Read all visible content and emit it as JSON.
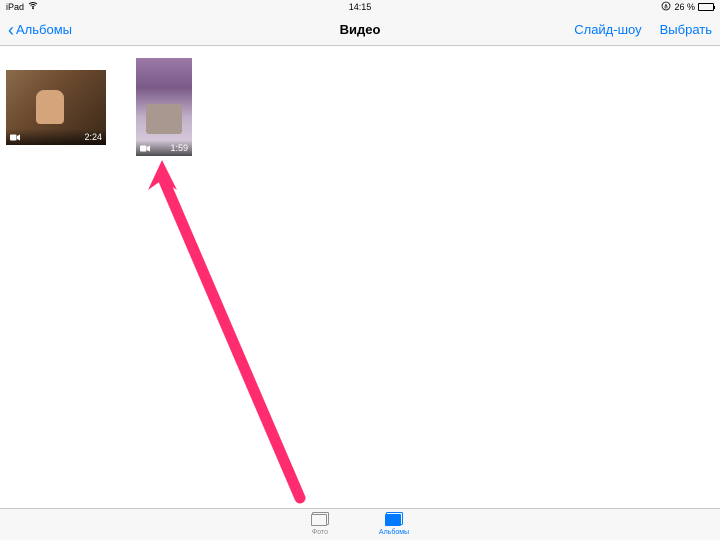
{
  "status": {
    "device": "iPad",
    "time": "14:15",
    "battery_pct": "26 %"
  },
  "nav": {
    "back_label": "Альбомы",
    "title": "Видео",
    "slideshow": "Слайд-шоу",
    "select": "Выбрать"
  },
  "videos": [
    {
      "duration": "2:24"
    },
    {
      "duration": "1:59"
    }
  ],
  "tabs": {
    "photos": "Фото",
    "albums": "Альбомы"
  },
  "annotation": {
    "arrow_color": "#ff2d6f"
  }
}
